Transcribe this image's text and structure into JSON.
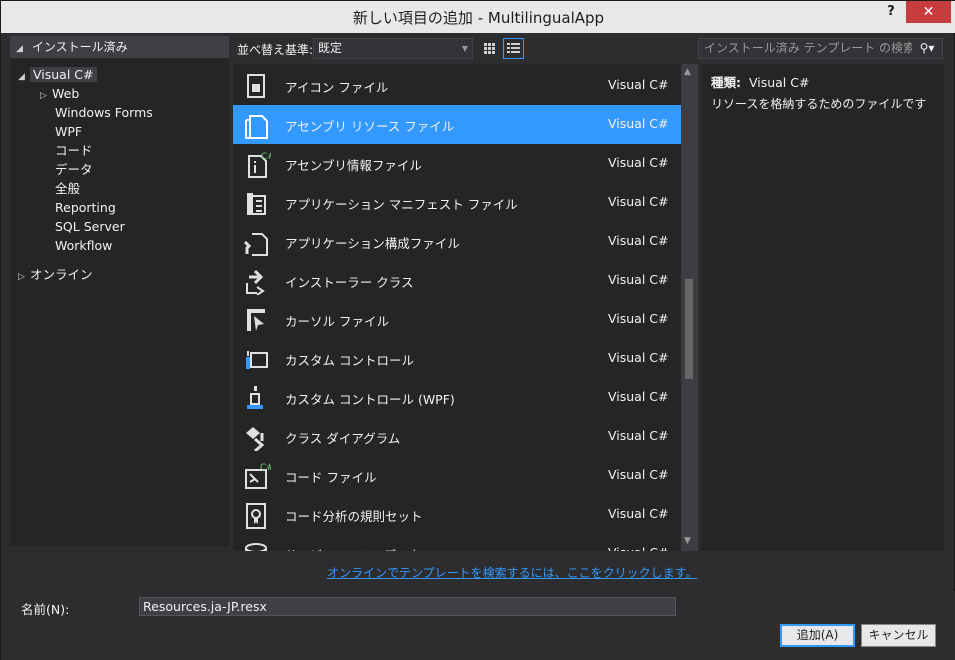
{
  "window": {
    "title": "新しい項目の追加 - MultilingualApp",
    "help": "?",
    "close": "✕"
  },
  "left": {
    "header": "インストール済み",
    "tree": {
      "root": "Visual C#",
      "children": [
        "Web",
        "Windows Forms",
        "WPF",
        "コード",
        "データ",
        "全般",
        "Reporting",
        "SQL Server",
        "Workflow"
      ],
      "online": "オンライン"
    }
  },
  "toolbar": {
    "sort_label": "並べ替え基準:",
    "sort_value": "既定",
    "search_placeholder": "インストール済み テンプレート の検索 (Ctrl+E)"
  },
  "items": [
    {
      "name": "アイコン ファイル",
      "lang": "Visual C#",
      "icon": "icon-file-icon"
    },
    {
      "name": "アセンブリ リソース ファイル",
      "lang": "Visual C#",
      "icon": "resource-file-icon",
      "selected": true
    },
    {
      "name": "アセンブリ情報ファイル",
      "lang": "Visual C#",
      "icon": "assembly-info-icon"
    },
    {
      "name": "アプリケーション マニフェスト ファイル",
      "lang": "Visual C#",
      "icon": "manifest-icon"
    },
    {
      "name": "アプリケーション構成ファイル",
      "lang": "Visual C#",
      "icon": "config-file-icon"
    },
    {
      "name": "インストーラー クラス",
      "lang": "Visual C#",
      "icon": "installer-icon"
    },
    {
      "name": "カーソル ファイル",
      "lang": "Visual C#",
      "icon": "cursor-icon"
    },
    {
      "name": "カスタム コントロール",
      "lang": "Visual C#",
      "icon": "custom-control-icon"
    },
    {
      "name": "カスタム コントロール (WPF)",
      "lang": "Visual C#",
      "icon": "wpf-control-icon"
    },
    {
      "name": "クラス ダイアグラム",
      "lang": "Visual C#",
      "icon": "class-diagram-icon"
    },
    {
      "name": "コード ファイル",
      "lang": "Visual C#",
      "icon": "code-file-icon"
    },
    {
      "name": "コード分析の規則セット",
      "lang": "Visual C#",
      "icon": "ruleset-icon"
    },
    {
      "name": "サービスベースのデータベース",
      "lang": "Visual C#",
      "icon": "database-icon"
    }
  ],
  "details": {
    "type_label": "種類:",
    "type_value": "Visual C#",
    "description": "リソースを格納するためのファイルです"
  },
  "online_link": "オンラインでテンプレートを検索するには、ここをクリックします。",
  "bottom": {
    "name_label": "名前(N):",
    "name_value": "Resources.ja-JP.resx",
    "ok": "追加(A)",
    "cancel": "キャンセル"
  }
}
